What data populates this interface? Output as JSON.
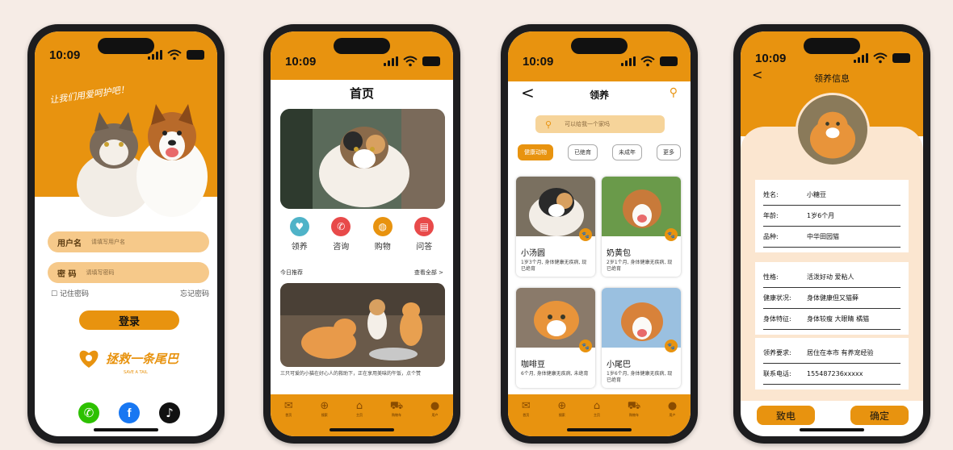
{
  "status": {
    "time": "10:09"
  },
  "login": {
    "slogan": "让我们用爱呵护吧！",
    "username_label": "用户名",
    "username_placeholder": "请填写用户名",
    "password_label": "密 码",
    "password_placeholder": "请填写密码",
    "remember": "记住密码",
    "forgot": "忘记密码",
    "login_button": "登录",
    "logo_text": "拯救一条尾巴",
    "logo_sub": "SAVE A TAIL",
    "social": [
      {
        "icon": "wechat-icon",
        "color": "#2dc100",
        "glyph": "✆"
      },
      {
        "icon": "facebook-icon",
        "color": "#1877f2",
        "glyph": "f"
      },
      {
        "icon": "tiktok-icon",
        "color": "#111111",
        "glyph": "♪"
      }
    ]
  },
  "home": {
    "title": "首页",
    "quick": [
      {
        "label": "领养",
        "icon": "heart-icon",
        "color": "#4fb3c8",
        "glyph": "♥"
      },
      {
        "label": "咨询",
        "icon": "phone-icon",
        "color": "#e84a4a",
        "glyph": "✆"
      },
      {
        "label": "购物",
        "icon": "shop-icon",
        "color": "#e8930f",
        "glyph": "◍"
      },
      {
        "label": "问答",
        "icon": "clipboard-icon",
        "color": "#e84a4a",
        "glyph": "▤"
      }
    ],
    "section_title": "今日推荐",
    "section_more": "查看全部 >",
    "story_caption": "三只可爱的小猫在好心人的救助下，正在享用美味的午饭，点个赞"
  },
  "tabs": [
    {
      "label": "首页",
      "icon": "mail-icon",
      "glyph": "✉"
    },
    {
      "label": "搜索",
      "icon": "globe-icon",
      "glyph": "⊕"
    },
    {
      "label": "主页",
      "icon": "home-icon",
      "glyph": "⌂"
    },
    {
      "label": "购物车",
      "icon": "cart-icon",
      "glyph": "⛟"
    },
    {
      "label": "用户",
      "icon": "user-icon",
      "glyph": "●"
    }
  ],
  "adopt": {
    "back": "<",
    "title": "领养",
    "search_placeholder": "可以给我一个家吗",
    "chips": [
      "健康动物",
      "已绝育",
      "未成年",
      "更多"
    ],
    "cards": [
      {
        "name": "小汤圆",
        "desc": "1岁3个月, 身体健康无疾病, 现已绝育"
      },
      {
        "name": "奶黄包",
        "desc": "2岁1个月, 身体健康无疾病, 现已绝育"
      },
      {
        "name": "咖啡豆",
        "desc": "6个月, 身体健康无疾病, 未绝育"
      },
      {
        "name": "小尾巴",
        "desc": "1岁6个月, 身体健康无疾病, 现已绝育"
      }
    ]
  },
  "info": {
    "back": "<",
    "title": "领养信息",
    "group1": [
      {
        "k": "姓名:",
        "v": "小糖豆"
      },
      {
        "k": "年龄:",
        "v": "1岁6个月"
      },
      {
        "k": "品种:",
        "v": "中华田园猫"
      }
    ],
    "group2": [
      {
        "k": "性格:",
        "v": "活泼好动 爱粘人"
      },
      {
        "k": "健康状况:",
        "v": "身体健康但又猫藓"
      },
      {
        "k": "身体特征:",
        "v": "身体较瘦 大眼睛 橘猫"
      }
    ],
    "group3": [
      {
        "k": "领养要求:",
        "v": "居住在本市 有养宠经验"
      },
      {
        "k": "联系电话:",
        "v": "155487236xxxxx"
      }
    ],
    "call_button": "致电",
    "confirm_button": "确定"
  }
}
